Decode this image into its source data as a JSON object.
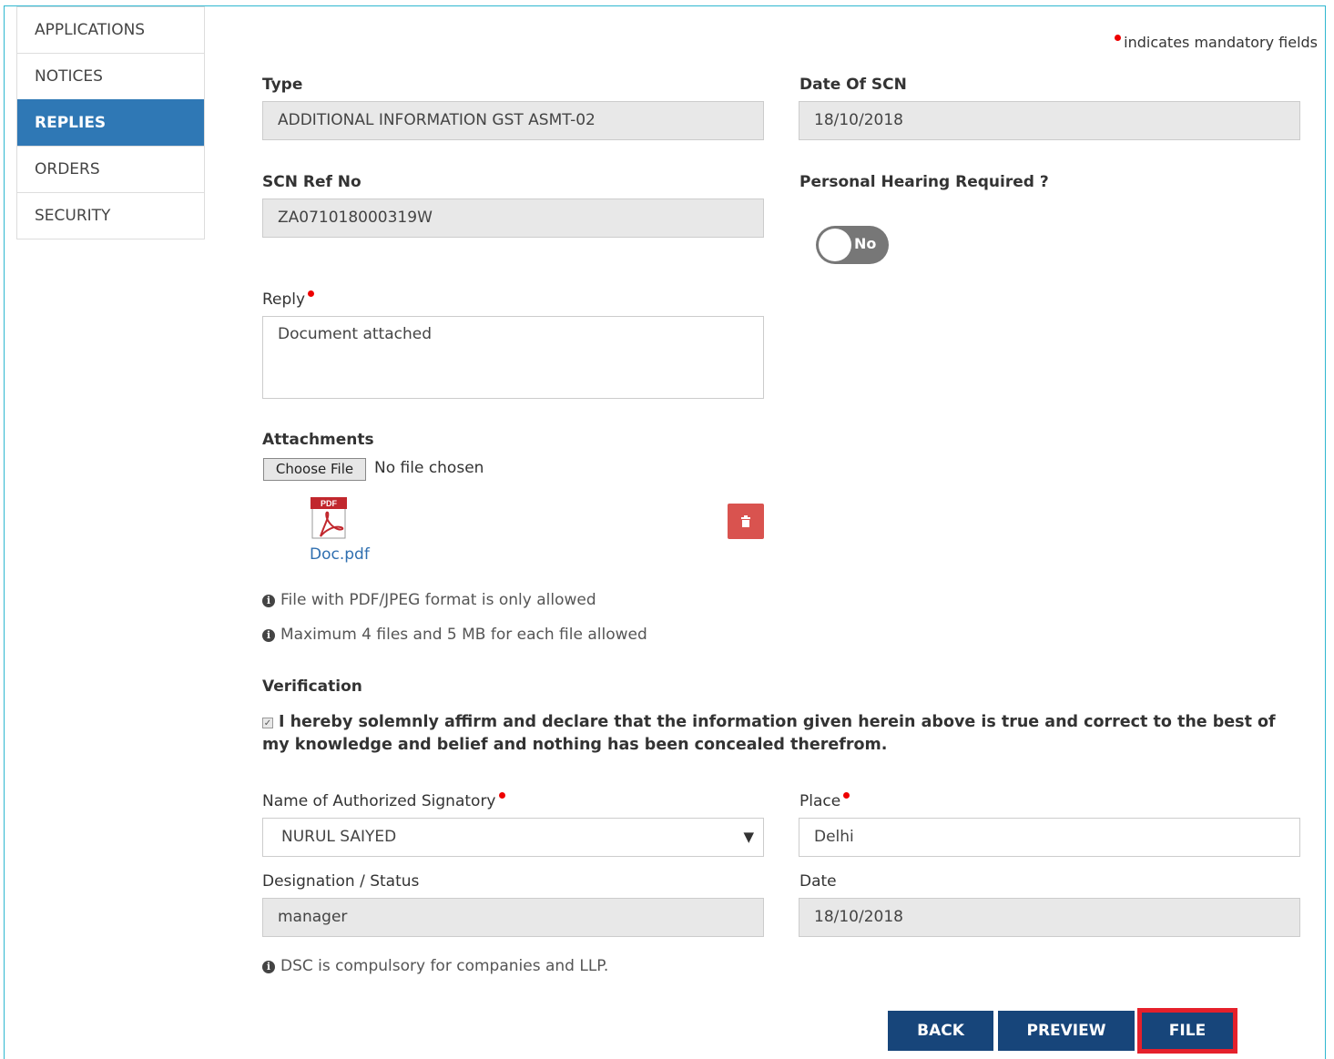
{
  "mandatory_note": "indicates mandatory fields",
  "sidebar": {
    "items": [
      {
        "label": "APPLICATIONS",
        "active": false
      },
      {
        "label": "NOTICES",
        "active": false
      },
      {
        "label": "REPLIES",
        "active": true
      },
      {
        "label": "ORDERS",
        "active": false
      },
      {
        "label": "SECURITY",
        "active": false
      }
    ]
  },
  "form": {
    "type": {
      "label": "Type",
      "value": "ADDITIONAL INFORMATION GST ASMT-02"
    },
    "date_of_scn": {
      "label": "Date Of SCN",
      "value": "18/10/2018"
    },
    "scn_ref_no": {
      "label": "SCN Ref No",
      "value": "ZA071018000319W"
    },
    "personal_hearing": {
      "label": "Personal Hearing Required ?",
      "toggle_text": "No"
    },
    "reply": {
      "label": "Reply",
      "value": "Document attached"
    },
    "attachments": {
      "label": "Attachments",
      "choose_button": "Choose File",
      "no_file_text": "No file chosen",
      "file_name": "Doc.pdf",
      "pdf_badge": "PDF"
    },
    "info_format": "File with PDF/JPEG format is only allowed",
    "info_max": "Maximum 4 files and 5 MB for each file allowed",
    "verification": {
      "label": "Verification",
      "statement": "I hereby solemnly affirm and declare that the information given herein above is true and correct to the best of my knowledge and belief and nothing has been concealed therefrom.",
      "checked": true
    },
    "signatory": {
      "label": "Name of Authorized Signatory",
      "value": "NURUL SAIYED"
    },
    "place": {
      "label": "Place",
      "value": "Delhi"
    },
    "designation": {
      "label": "Designation / Status",
      "value": "manager"
    },
    "date": {
      "label": "Date",
      "value": "18/10/2018"
    },
    "info_dsc": "DSC is compulsory for companies and LLP."
  },
  "buttons": {
    "back": "BACK",
    "preview": "PREVIEW",
    "file": "FILE"
  },
  "colors": {
    "active_nav": "#2f78b5",
    "button": "#17457a",
    "highlight": "#e5202b",
    "delete": "#d9534f",
    "frame": "#2fb7d0"
  }
}
